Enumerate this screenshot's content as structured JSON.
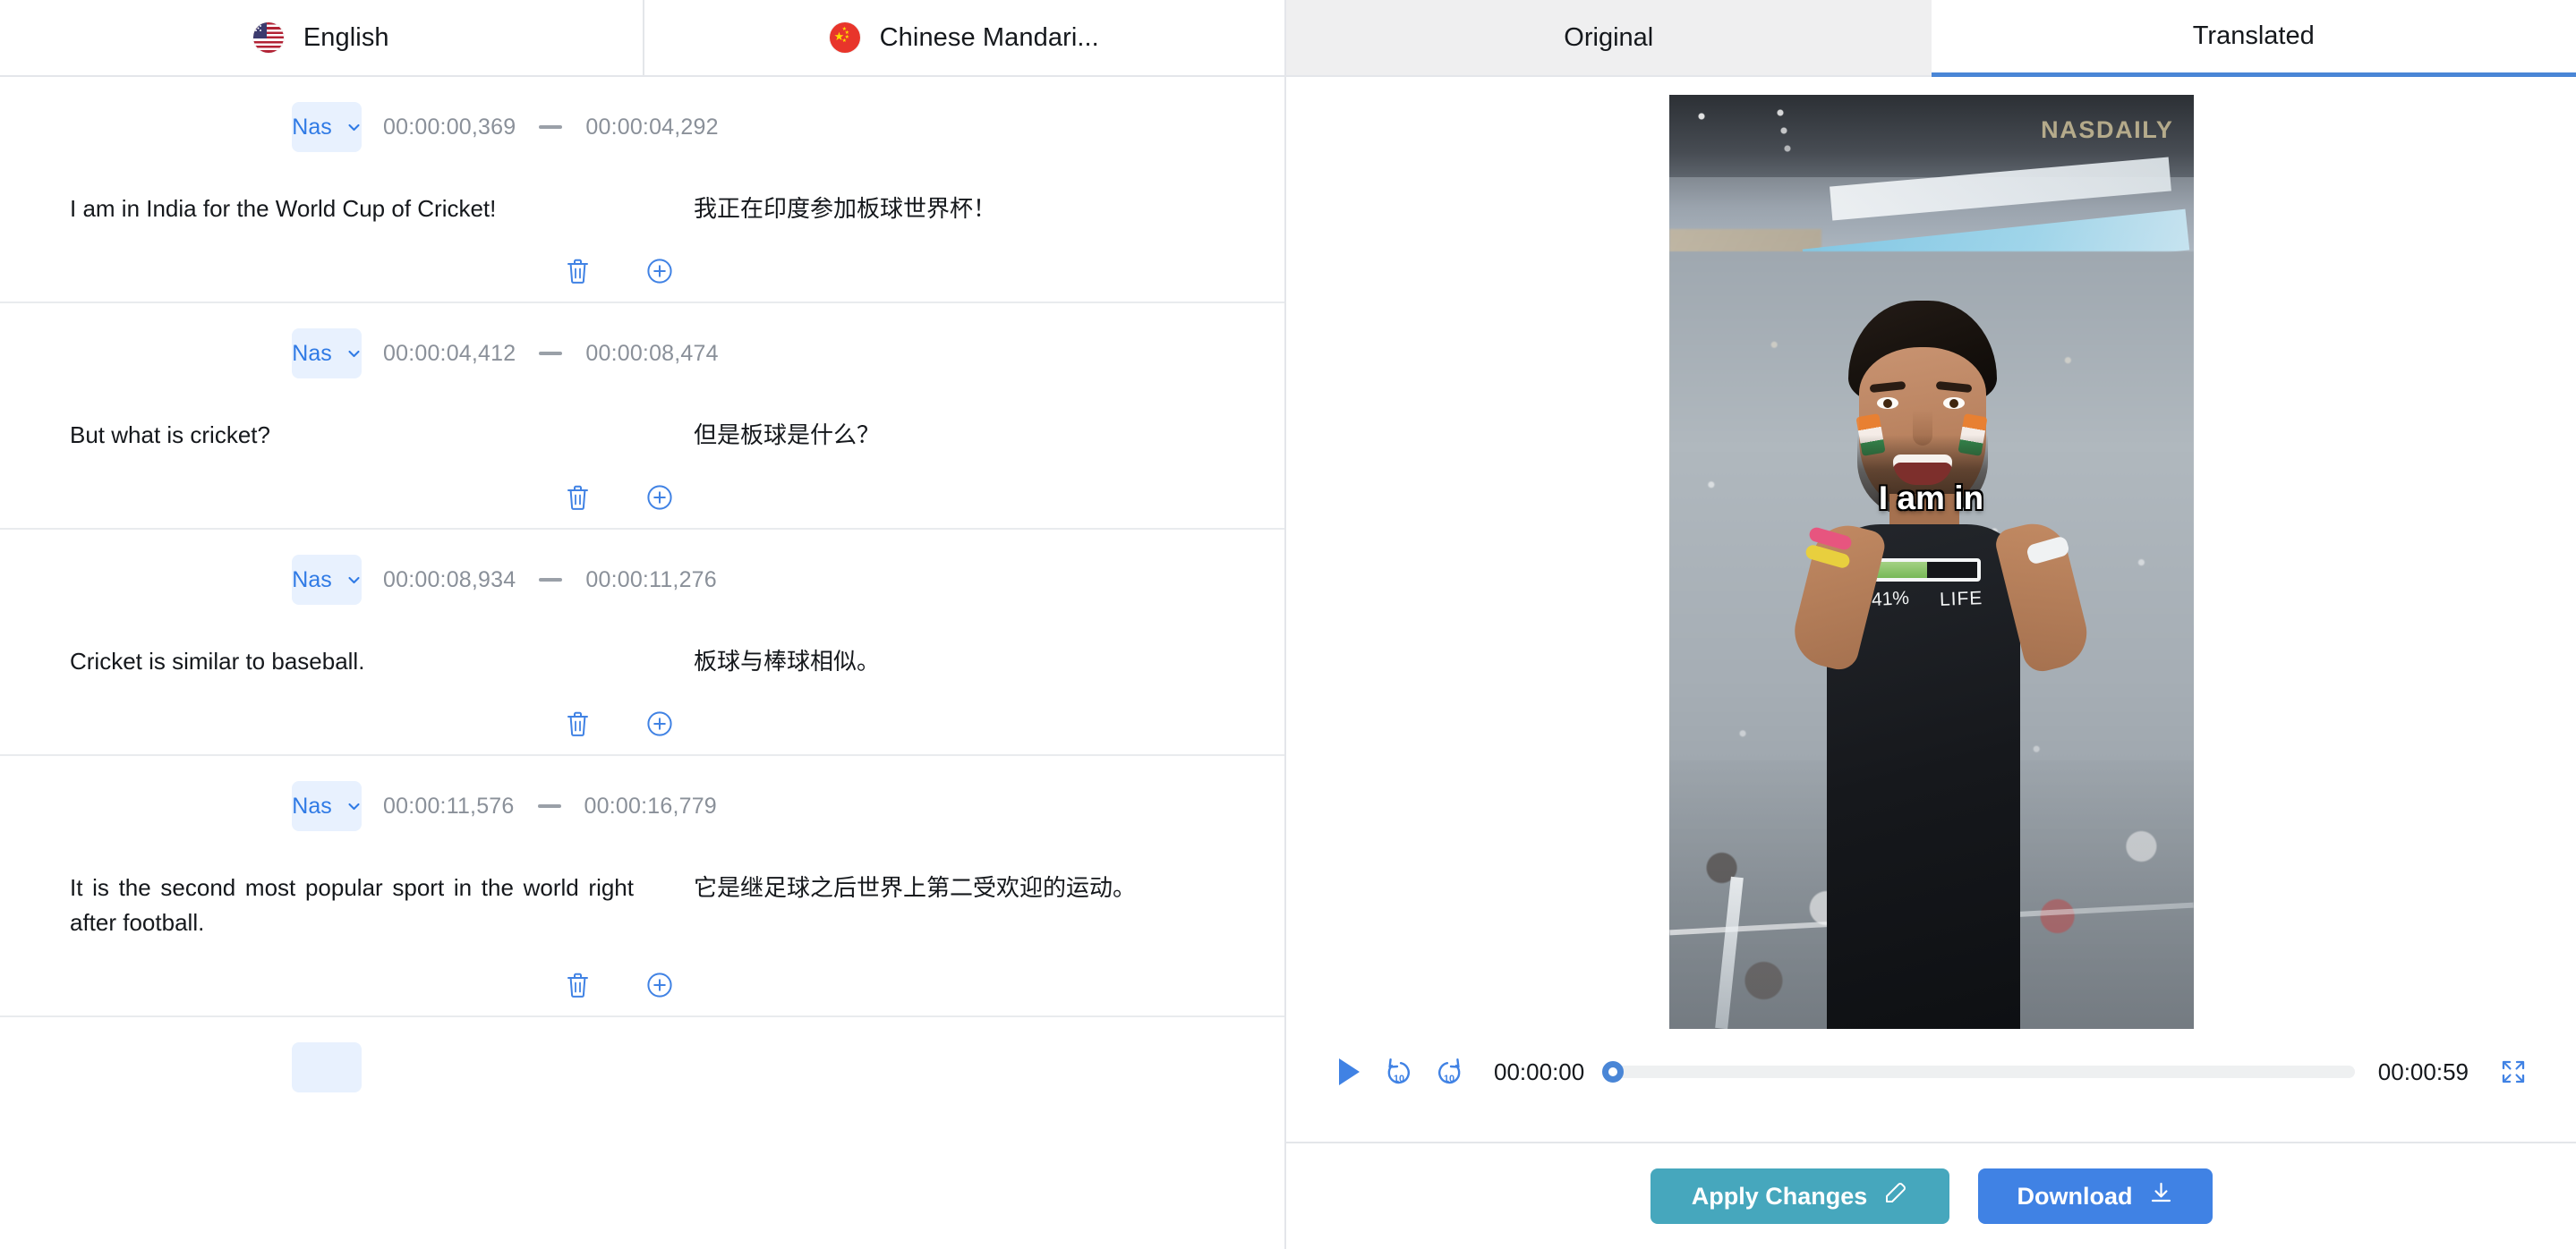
{
  "language_tabs": [
    {
      "label": "English",
      "flag": "flag-us-icon",
      "active": false
    },
    {
      "label": "Chinese Mandari...",
      "flag": "flag-cn-icon",
      "active": false
    }
  ],
  "view_tabs": [
    {
      "label": "Original",
      "active": false
    },
    {
      "label": "Translated",
      "active": true
    }
  ],
  "subtitles": [
    {
      "speaker": "Nas",
      "start": "00:00:00,369",
      "end": "00:00:04,292",
      "source_text": "I am in India for the World Cup of Cricket!",
      "translated_text": "我正在印度参加板球世界杯！"
    },
    {
      "speaker": "Nas",
      "start": "00:00:04,412",
      "end": "00:00:08,474",
      "source_text": "But what is cricket?",
      "translated_text": "但是板球是什么？"
    },
    {
      "speaker": "Nas",
      "start": "00:00:08,934",
      "end": "00:00:11,276",
      "source_text": "Cricket is similar to baseball.",
      "translated_text": "板球与棒球相似。"
    },
    {
      "speaker": "Nas",
      "start": "00:00:11,576",
      "end": "00:00:16,779",
      "source_text": "It is the second most popular sport in the world right after football.",
      "translated_text": "它是继足球之后世界上第二受欢迎的运动。"
    }
  ],
  "row_actions": {
    "delete_label": "delete-subtitle",
    "add_label": "add-subtitle"
  },
  "video": {
    "watermark": "NASDAILY",
    "caption": "I am in",
    "shirt_percent": "41%",
    "shirt_word": "LIFE"
  },
  "player": {
    "current_time": "00:00:00",
    "duration": "00:00:59",
    "progress_percent": 0,
    "play_label": "play",
    "rewind_label": "10",
    "forward_label": "10"
  },
  "footer": {
    "apply_label": "Apply Changes",
    "download_label": "Download"
  },
  "colors": {
    "accent_blue": "#4082e4",
    "teal": "#46a7bd",
    "chip_blue": "#2f7ae5",
    "chip_bg": "#e8f1fe",
    "muted": "#8a9099"
  }
}
